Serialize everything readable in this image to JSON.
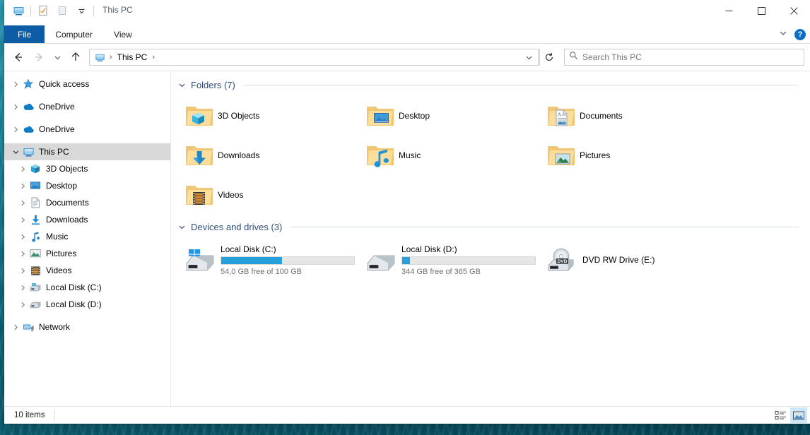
{
  "window": {
    "title": "This PC",
    "quick_access_icons": [
      "this-pc-icon",
      "properties-icon",
      "new-folder-icon",
      "customize-dropdown-icon"
    ],
    "controls": {
      "minimize": "minimize-icon",
      "maximize": "maximize-icon",
      "close": "close-icon"
    }
  },
  "ribbon": {
    "tabs": [
      {
        "label": "File",
        "active": true
      },
      {
        "label": "Computer",
        "active": false
      },
      {
        "label": "View",
        "active": false
      }
    ],
    "collapse_icon": "chevron-down-icon",
    "help_label": "?"
  },
  "address": {
    "back_icon": "arrow-left-icon",
    "forward_icon": "arrow-right-icon",
    "recent_icon": "chevron-down-icon",
    "up_icon": "arrow-up-icon",
    "breadcrumb_icon": "this-pc-icon",
    "breadcrumb": "This PC",
    "separator": "›",
    "dropdown_icon": "chevron-down-icon",
    "refresh_icon": "refresh-icon"
  },
  "search": {
    "icon": "search-icon",
    "placeholder": "Search This PC",
    "value": ""
  },
  "sidebar": {
    "items": [
      {
        "label": "Quick access",
        "icon": "star-icon",
        "level": 0,
        "chevron": "collapsed",
        "selected": false,
        "gap_after": true
      },
      {
        "label": "OneDrive",
        "icon": "cloud-icon",
        "level": 0,
        "chevron": "collapsed",
        "selected": false,
        "gap_after": true
      },
      {
        "label": "OneDrive",
        "icon": "cloud-icon",
        "level": 0,
        "chevron": "collapsed",
        "selected": false,
        "gap_after": true
      },
      {
        "label": "This PC",
        "icon": "this-pc-icon",
        "level": 0,
        "chevron": "expanded",
        "selected": true,
        "gap_after": false
      },
      {
        "label": "3D Objects",
        "icon": "3d-objects-icon",
        "level": 1,
        "chevron": "collapsed",
        "selected": false,
        "gap_after": false
      },
      {
        "label": "Desktop",
        "icon": "desktop-icon",
        "level": 1,
        "chevron": "collapsed",
        "selected": false,
        "gap_after": false
      },
      {
        "label": "Documents",
        "icon": "documents-icon",
        "level": 1,
        "chevron": "collapsed",
        "selected": false,
        "gap_after": false
      },
      {
        "label": "Downloads",
        "icon": "downloads-icon",
        "level": 1,
        "chevron": "collapsed",
        "selected": false,
        "gap_after": false
      },
      {
        "label": "Music",
        "icon": "music-icon",
        "level": 1,
        "chevron": "collapsed",
        "selected": false,
        "gap_after": false
      },
      {
        "label": "Pictures",
        "icon": "pictures-icon",
        "level": 1,
        "chevron": "collapsed",
        "selected": false,
        "gap_after": false
      },
      {
        "label": "Videos",
        "icon": "videos-icon",
        "level": 1,
        "chevron": "collapsed",
        "selected": false,
        "gap_after": false
      },
      {
        "label": "Local Disk (C:)",
        "icon": "hdd-c-icon",
        "level": 1,
        "chevron": "collapsed",
        "selected": false,
        "gap_after": false
      },
      {
        "label": "Local Disk (D:)",
        "icon": "hdd-icon",
        "level": 1,
        "chevron": "collapsed",
        "selected": false,
        "gap_after": true
      },
      {
        "label": "Network",
        "icon": "network-icon",
        "level": 0,
        "chevron": "collapsed",
        "selected": false,
        "gap_after": false
      }
    ]
  },
  "main": {
    "folders_group": {
      "title": "Folders (7)",
      "chevron": "chevron-down-icon",
      "items": [
        {
          "name": "3D Objects",
          "icon": "folder-3d-objects-icon"
        },
        {
          "name": "Desktop",
          "icon": "folder-desktop-icon"
        },
        {
          "name": "Documents",
          "icon": "folder-documents-icon"
        },
        {
          "name": "Downloads",
          "icon": "folder-downloads-icon"
        },
        {
          "name": "Music",
          "icon": "folder-music-icon"
        },
        {
          "name": "Pictures",
          "icon": "folder-pictures-icon"
        },
        {
          "name": "Videos",
          "icon": "folder-videos-icon"
        }
      ]
    },
    "devices_group": {
      "title": "Devices and drives (3)",
      "chevron": "chevron-down-icon",
      "items": [
        {
          "name": "Local Disk (C:)",
          "icon": "drive-windows-icon",
          "has_bar": true,
          "used_percent": 46,
          "capacity_text": "54,0 GB free of 100 GB",
          "bar_color": "#26a0da"
        },
        {
          "name": "Local Disk (D:)",
          "icon": "drive-icon",
          "has_bar": true,
          "used_percent": 6,
          "capacity_text": "344 GB free of 365 GB",
          "bar_color": "#26a0da"
        },
        {
          "name": "DVD RW Drive (E:)",
          "icon": "dvd-drive-icon",
          "has_bar": false,
          "used_percent": 0,
          "capacity_text": "",
          "bar_color": "#26a0da"
        }
      ]
    }
  },
  "status": {
    "item_count": "10 items",
    "details_view_icon": "details-view-icon",
    "large_icons_view_icon": "large-icons-view-icon",
    "active_view": "large-icons"
  }
}
